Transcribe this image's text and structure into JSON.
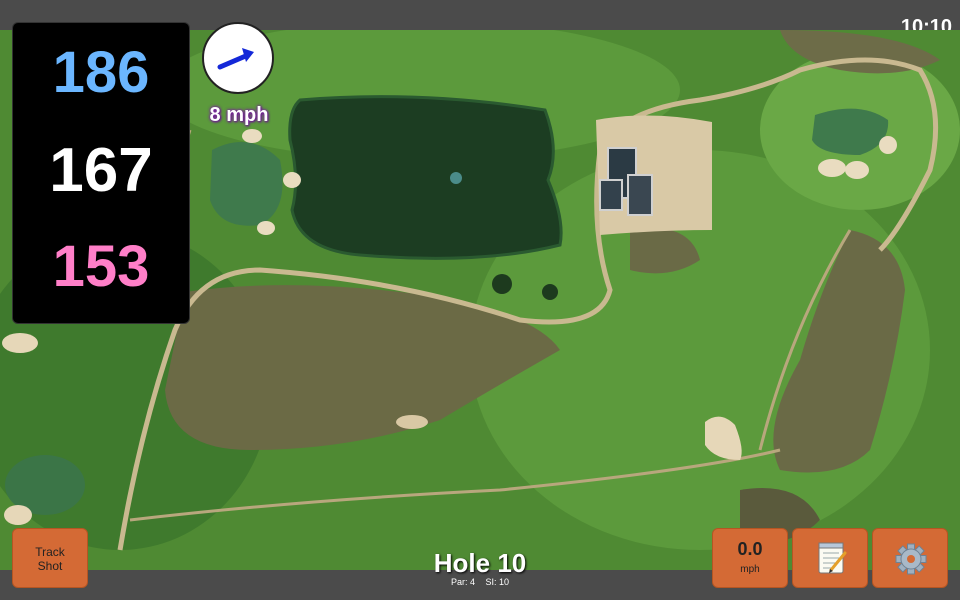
{
  "status": {
    "clock": "10:10"
  },
  "distances": {
    "back": "186",
    "middle": "167",
    "front": "153"
  },
  "wind": {
    "speed": "8 mph",
    "direction_icon": "arrow-icon"
  },
  "buttons": {
    "track_shot": {
      "line1": "Track",
      "line2": "Shot"
    },
    "speed": {
      "value": "0.0",
      "unit": "mph"
    },
    "notes_icon": "notepad-icon",
    "settings_icon": "gear-icon"
  },
  "hole": {
    "title": "Hole 10",
    "par": "Par: 4",
    "si": "SI: 10"
  },
  "colors": {
    "back": "#6bb6ff",
    "middle": "#ffffff",
    "front": "#ff7fc8",
    "button": "#d46a35"
  }
}
